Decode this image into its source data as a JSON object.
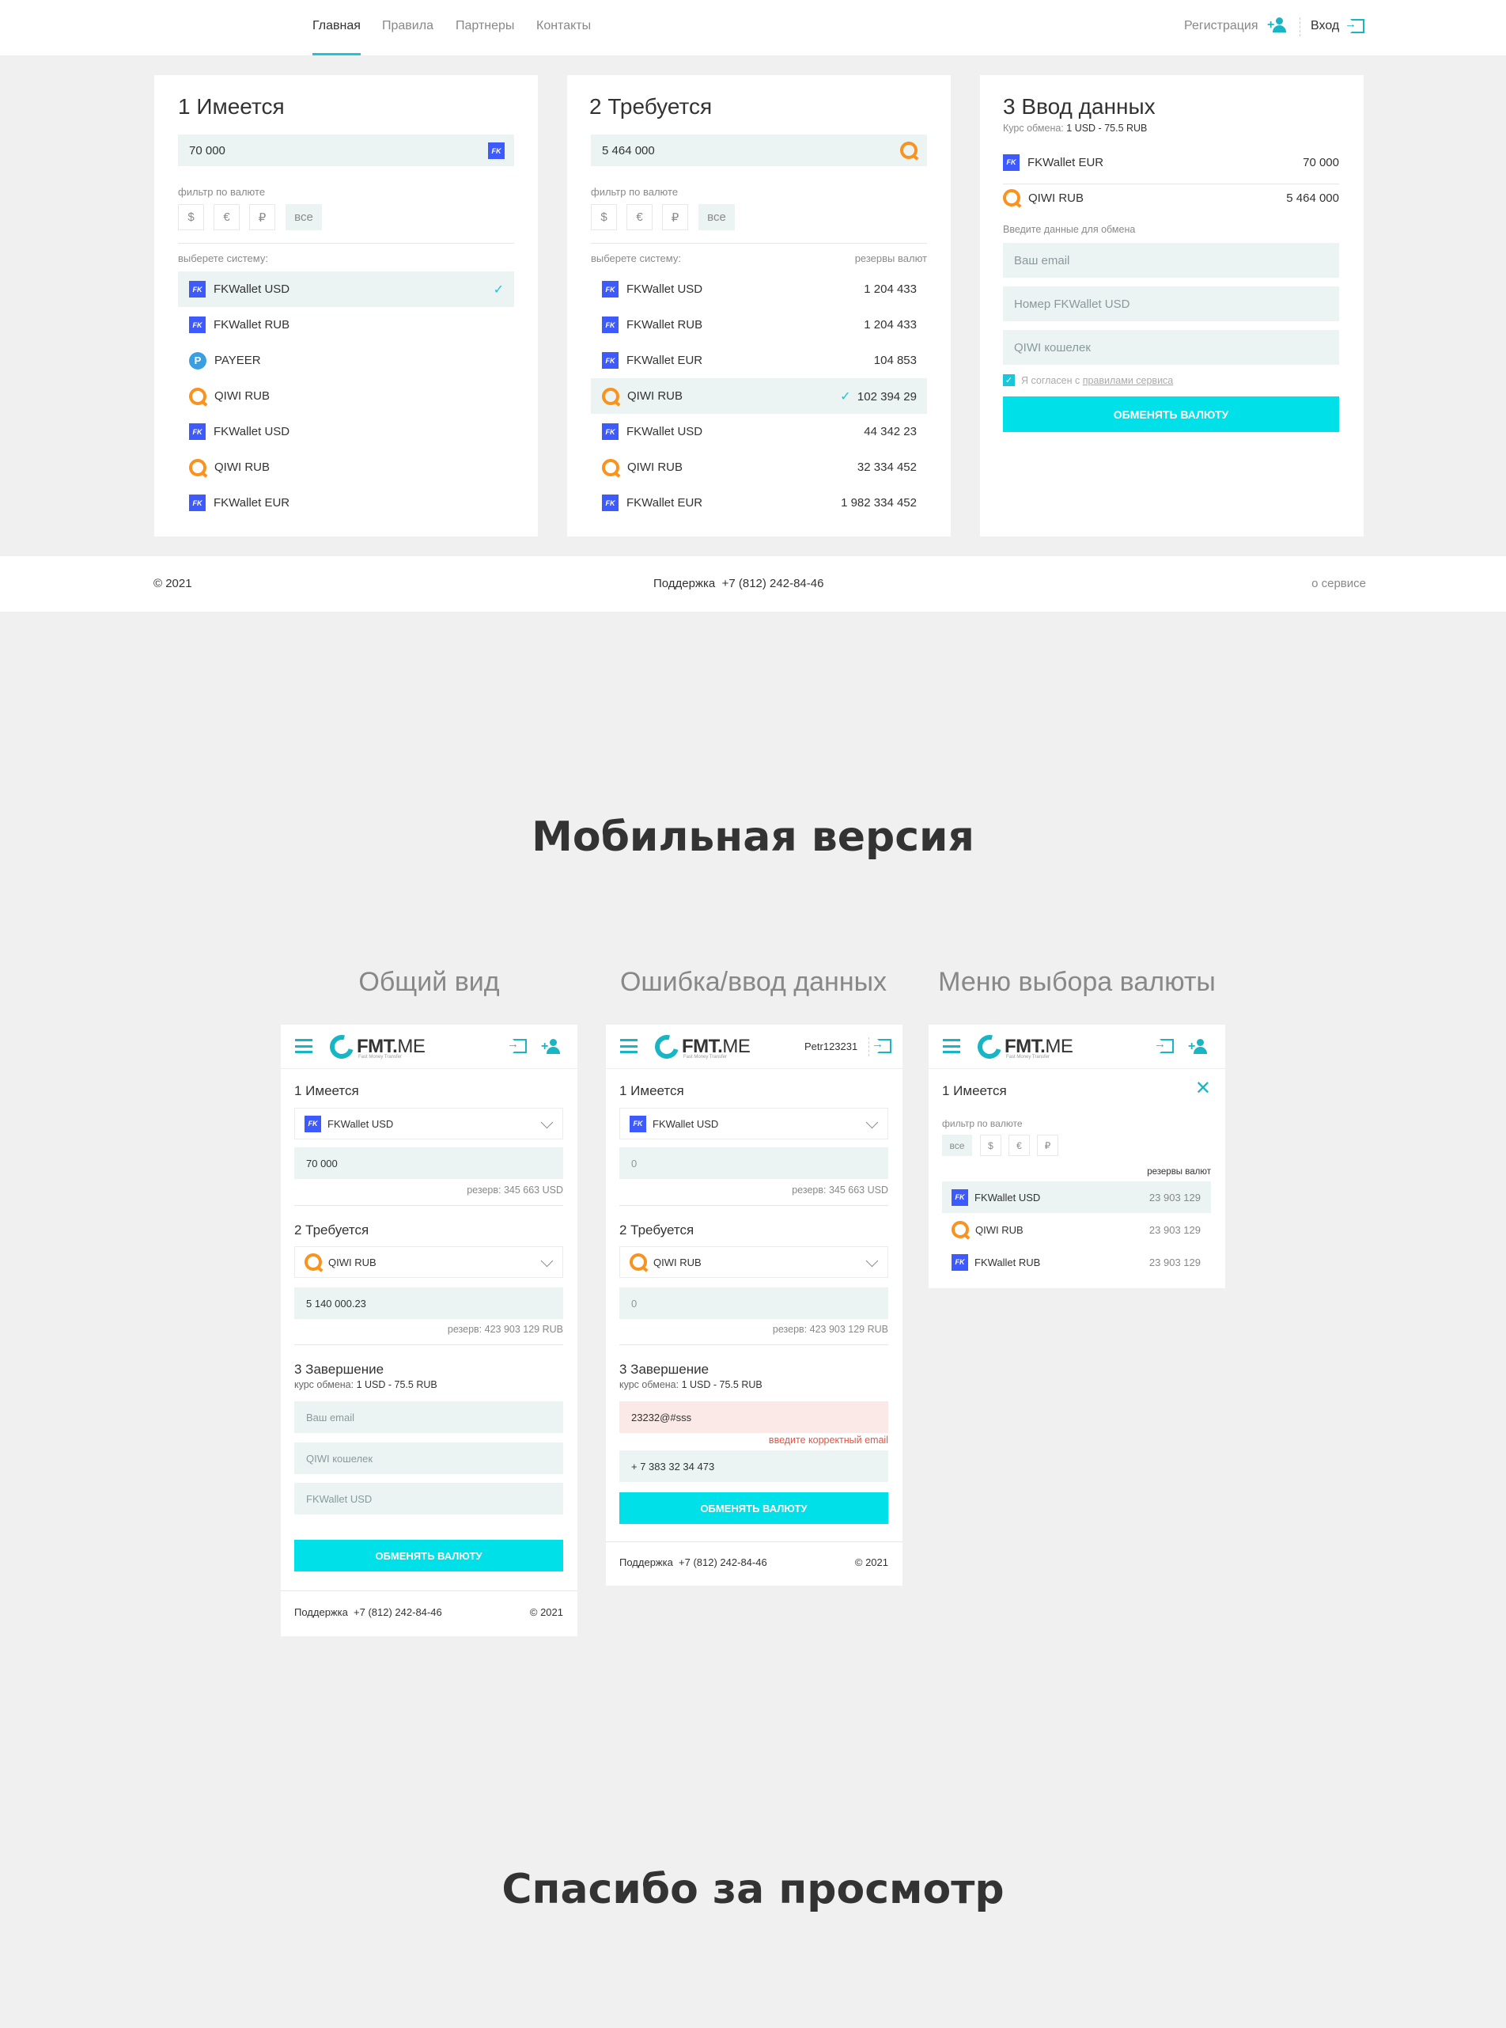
{
  "header": {
    "nav": [
      "Главная",
      "Правила",
      "Партнеры",
      "Контакты"
    ],
    "register": "Регистрация",
    "login": "Вход"
  },
  "have": {
    "title": "1 Имеется",
    "amount": "70 000",
    "filter_label": "фильтр по валюте",
    "filters": [
      "$",
      "€",
      "₽",
      "все"
    ],
    "choose_label": "выберете систему:",
    "items": [
      {
        "icon": "fkwallet",
        "name": "FKWallet USD",
        "selected": true
      },
      {
        "icon": "fkwallet",
        "name": "FKWallet RUB"
      },
      {
        "icon": "payeer",
        "name": "PAYEER"
      },
      {
        "icon": "qiwi",
        "name": "QIWI RUB"
      },
      {
        "icon": "fkwallet",
        "name": "FKWallet USD"
      },
      {
        "icon": "qiwi",
        "name": "QIWI RUB"
      },
      {
        "icon": "fkwallet",
        "name": "FKWallet EUR"
      }
    ]
  },
  "need": {
    "title": "2 Требуется",
    "amount": "5 464 000",
    "filter_label": "фильтр по валюте",
    "filters": [
      "$",
      "€",
      "₽",
      "все"
    ],
    "choose_label": "выберете систему:",
    "reserves_label": "резервы валют",
    "items": [
      {
        "icon": "fkwallet",
        "name": "FKWallet USD",
        "reserve": "1 204 433"
      },
      {
        "icon": "fkwallet",
        "name": "FKWallet RUB",
        "reserve": "1 204 433"
      },
      {
        "icon": "fkwallet",
        "name": "FKWallet EUR",
        "reserve": "104 853"
      },
      {
        "icon": "qiwi",
        "name": "QIWI RUB",
        "reserve": "102 394 29",
        "selected": true
      },
      {
        "icon": "fkwallet",
        "name": "FKWallet USD",
        "reserve": "44 342 23"
      },
      {
        "icon": "qiwi",
        "name": "QIWI RUB",
        "reserve": "32 334 452"
      },
      {
        "icon": "fkwallet",
        "name": "FKWallet EUR",
        "reserve": "1 982 334 452"
      }
    ]
  },
  "input": {
    "title": "3 Ввод данных",
    "rate_label": "Курс обмена:",
    "rate": "1 USD - 75.5 RUB",
    "give": {
      "name": "FKWallet EUR",
      "amount": "70 000"
    },
    "get": {
      "name": "QIWI RUB",
      "amount": "5 464 000"
    },
    "enter_label": "Введите данные для обмена",
    "email_ph": "Ваш email",
    "fk_ph": "Номер FKWallet USD",
    "qiwi_ph": "QIWI кошелек",
    "agree_text": "Я согласен с",
    "agree_link": "правилами сервиса",
    "button": "ОБМЕНЯТЬ ВАЛЮТУ"
  },
  "footer": {
    "copy": "© 2021",
    "support": "Поддержка  +7 (812) 242-84-46",
    "about": "о сервисе"
  },
  "mobile_title": "Мобильная версия",
  "mobile_subtitles": [
    "Общий вид",
    "Ошибка/ввод данных",
    "Меню выбора валюты"
  ],
  "logo": {
    "brand": "FMT.",
    "suffix": "ME",
    "tagline": "Fast Money Transfer"
  },
  "mob1": {
    "have_title": "1 Имеется",
    "have_sys": "FKWallet USD",
    "have_amount": "70 000",
    "have_reserve": "резерв: 345 663 USD",
    "need_title": "2 Требуется",
    "need_sys": "QIWI RUB",
    "need_amount": "5 140 000.23",
    "need_reserve": "резерв: 423 903 129 RUB",
    "fin_title": "3 Завершение",
    "rate_label": "курс обмена:",
    "rate": "1 USD - 75.5 RUB",
    "email_ph": "Ваш email",
    "qiwi_ph": "QIWI кошелек",
    "fk_ph": "FKWallet USD",
    "button": "ОБМЕНЯТЬ ВАЛЮТУ",
    "support": "Поддержка  +7 (812) 242-84-46",
    "copy": "© 2021"
  },
  "mob2": {
    "user": "Petr123231",
    "have_title": "1 Имеется",
    "have_sys": "FKWallet USD",
    "have_amount": "0",
    "have_reserve": "резерв: 345 663 USD",
    "need_title": "2 Требуется",
    "need_sys": "QIWI RUB",
    "need_amount": "0",
    "need_reserve": "резерв: 423 903 129 RUB",
    "fin_title": "3 Завершение",
    "rate_label": "курс обмена:",
    "rate": "1 USD - 75.5 RUB",
    "email_value": "23232@#sss",
    "error": "введите корректный email",
    "phone_value": "+ 7 383 32 34 473",
    "button": "ОБМЕНЯТЬ ВАЛЮТУ",
    "support": "Поддержка  +7 (812) 242-84-46",
    "copy": "© 2021"
  },
  "mob3": {
    "title": "1 Имеется",
    "filter_label": "фильтр по валюте",
    "filters": [
      "все",
      "$",
      "€",
      "₽"
    ],
    "reserves_label": "резервы валют",
    "items": [
      {
        "icon": "fkwallet",
        "name": "FKWallet USD",
        "reserve": "23 903 129",
        "selected": true
      },
      {
        "icon": "qiwi",
        "name": "QIWI RUB",
        "reserve": "23 903 129"
      },
      {
        "icon": "fkwallet",
        "name": "FKWallet RUB",
        "reserve": "23 903 129"
      }
    ]
  },
  "thanks": "Спасибо за просмотр"
}
